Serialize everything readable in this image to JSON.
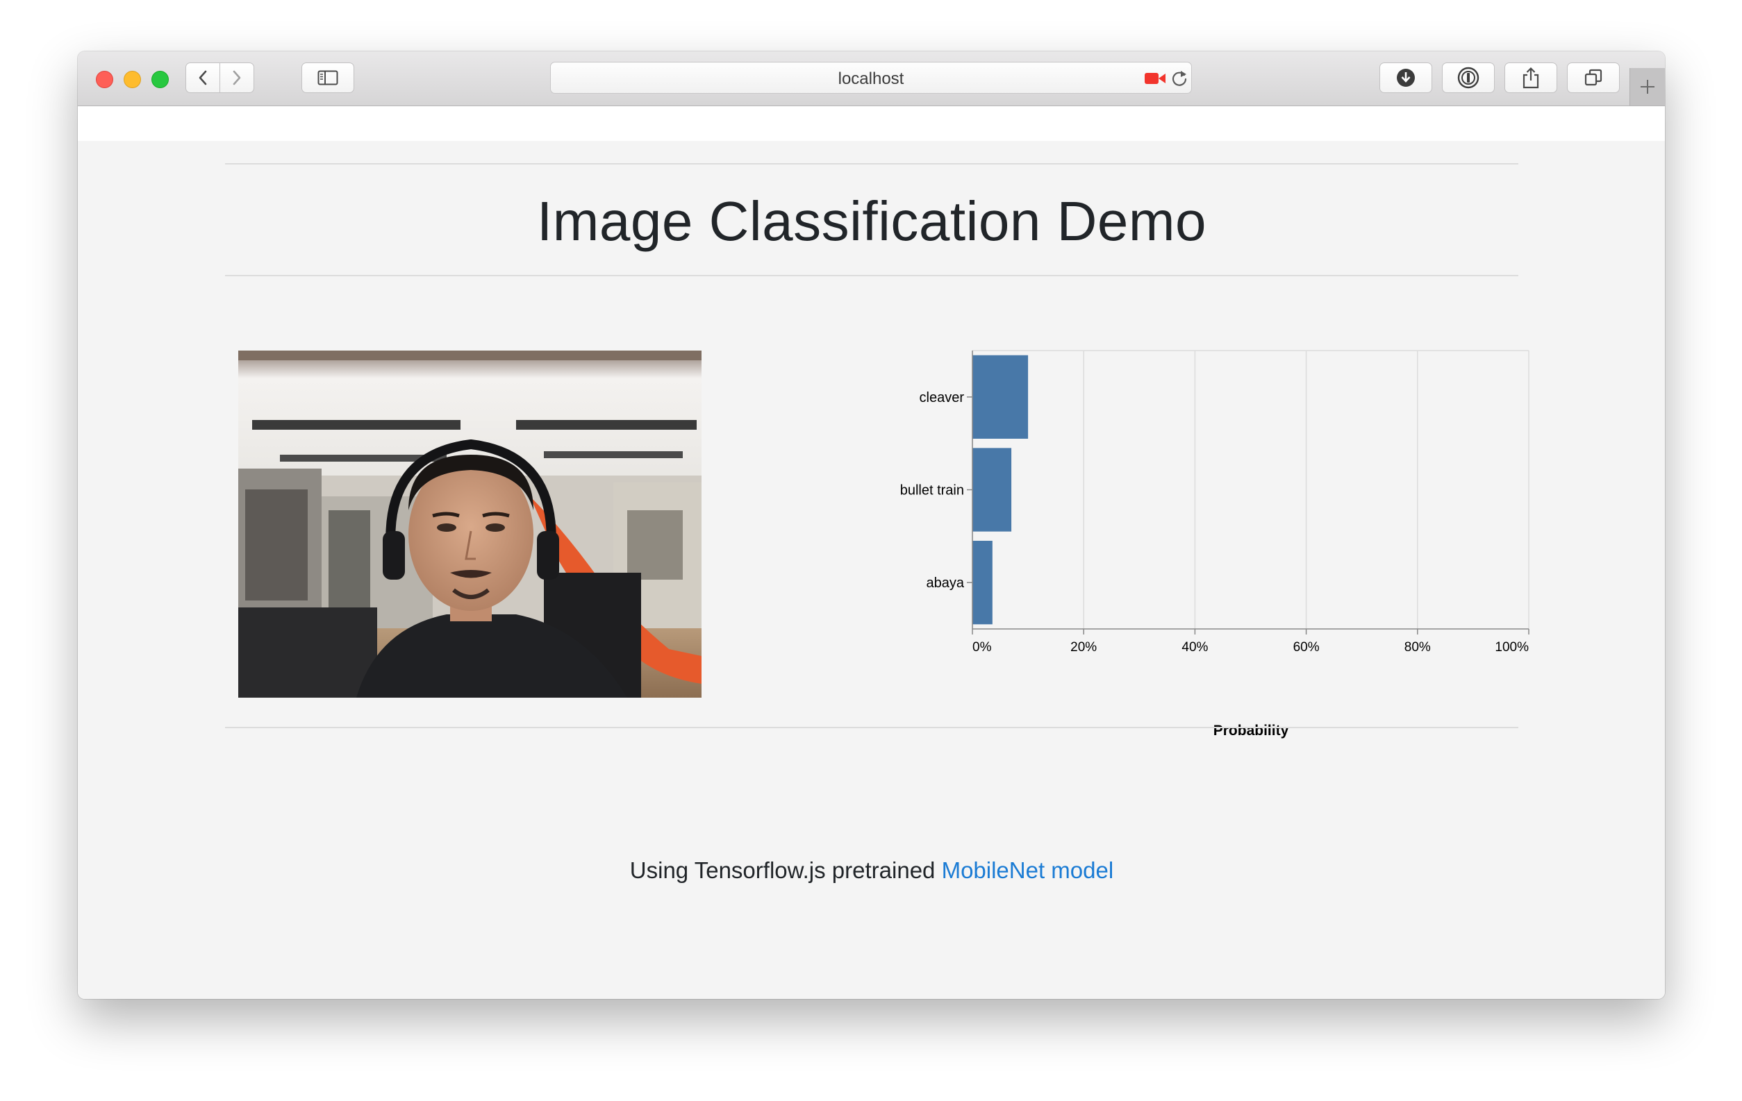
{
  "browser": {
    "address": "localhost",
    "icons": [
      "back-icon",
      "forward-icon",
      "sidebar-icon",
      "camera-recording-icon",
      "reload-icon",
      "download-icon",
      "password-icon",
      "share-icon",
      "tabs-icon",
      "new-tab-icon"
    ]
  },
  "page": {
    "title": "Image Classification Demo",
    "footer_prefix": "Using Tensorflow.js pretrained ",
    "footer_link": "MobileNet model"
  },
  "chart_data": {
    "type": "bar",
    "orientation": "horizontal",
    "categories": [
      "cleaver",
      "bullet train",
      "abaya"
    ],
    "values": [
      0.1,
      0.07,
      0.036
    ],
    "xlabel": "Probability",
    "xlim": [
      0,
      1
    ],
    "x_ticks": [
      "0%",
      "20%",
      "40%",
      "60%",
      "80%",
      "100%"
    ],
    "x_tick_values": [
      0,
      0.2,
      0.4,
      0.6,
      0.8,
      1.0
    ],
    "grid": true,
    "bar_color": "#4878a8"
  }
}
